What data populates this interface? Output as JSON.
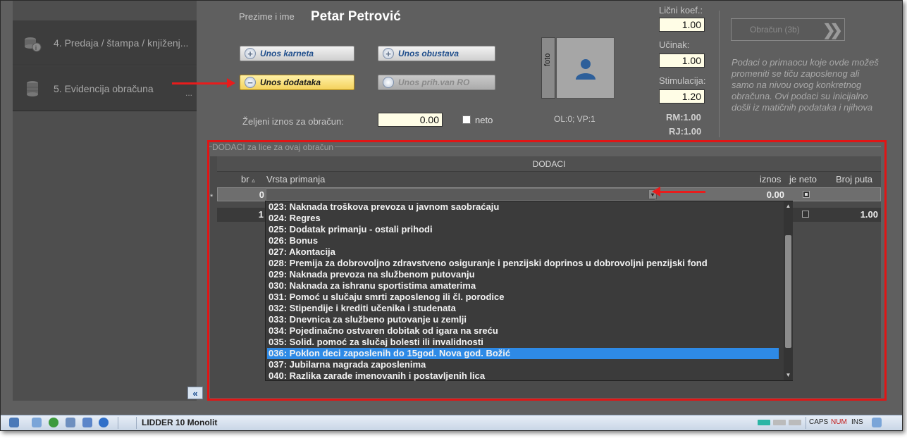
{
  "sidebar": {
    "items": [
      {
        "label": "4. Predaja / štampa / knjiženj...",
        "icon": "coins-info-icon"
      },
      {
        "label": "5. Evidencija obračuna",
        "more": "...",
        "icon": "coin-stack-icon"
      }
    ]
  },
  "employee": {
    "name_label": "Prezime i ime",
    "name": "Petar Petrović"
  },
  "buttons": {
    "unos_karneta": "Unos karneta",
    "unos_obustava": "Unos obustava",
    "unos_dodataka": "Unos dodataka",
    "unos_prih": "Unos prih.van RO"
  },
  "amount": {
    "label": "Željeni iznos za obračun:",
    "value": "0.00",
    "neto_label": "neto"
  },
  "photo": {
    "label": "foto",
    "ol_vp": "OL:0;  VP:1"
  },
  "coefficients": {
    "licni_label": "Lični koef.:",
    "licni": "1.00",
    "ucinak_label": "Učinak:",
    "ucinak": "1.00",
    "stimulacija_label": "Stimulacija:",
    "stimulacija": "1.20",
    "rm": "RM:1.00",
    "rj": "RJ:1.00"
  },
  "obracun": {
    "label": "Obračun (3b)"
  },
  "note": "Podaci o primaocu koje ovde možeš promeniti se tiču zaposlenog ali samo na nivou ovog konkretnog obračuna. Ovi podaci su inicijalno došli iz matičnih podataka i njihova",
  "grid": {
    "group_title": "DODACI za lice za ovaj obračun",
    "band": "DODACI",
    "columns": {
      "br": "br",
      "vrsta": "Vrsta primanja",
      "iznos": "iznos",
      "je_neto": "je neto",
      "broj_puta": "Broj puta"
    },
    "new_row": {
      "marker": "*",
      "br": "0",
      "iznos": "0.00"
    },
    "rows": [
      {
        "br": "1",
        "broj_puta": "1.00"
      }
    ]
  },
  "dropdown": {
    "items": [
      "023: Naknada troškova prevoza u javnom saobraćaju",
      "024: Regres",
      "025: Dodatak primanju - ostali prihodi",
      "026: Bonus",
      "027: Akontacija",
      "028: Premija za dobrovoljno zdravstveno osiguranje i penzijski doprinos u dobrovoljni penzijski fond",
      "029: Naknada prevoza na službenom putovanju",
      "030: Naknada za ishranu sportistima amaterima",
      "031: Pomoć u slučaju smrti zaposlenog ili čl. porodice",
      "032: Stipendije i krediti učenika i studenata",
      "033: Dnevnica za službeno putovanje u zemlji",
      "034: Pojedinačno ostvaren dobitak od igara na sreću",
      "035: Solid. pomoć za slučaj bolesti ili invalidnosti",
      "036: Poklon deci zaposlenih  do 15god. Nova god. Božić",
      "037: Jubilarna nagrada zaposlenima",
      "040: Razlika zarade imenovanih i postavljenih lica"
    ],
    "selected_index": 13
  },
  "statusbar": {
    "app": "LIDDER 10 Monolit",
    "caps": "CAPS",
    "num": "NUM",
    "ins": "INS"
  },
  "colors": {
    "highlight": "#2e8ae6",
    "annotation_red": "#e01515",
    "active_button": "#f4d25c"
  }
}
